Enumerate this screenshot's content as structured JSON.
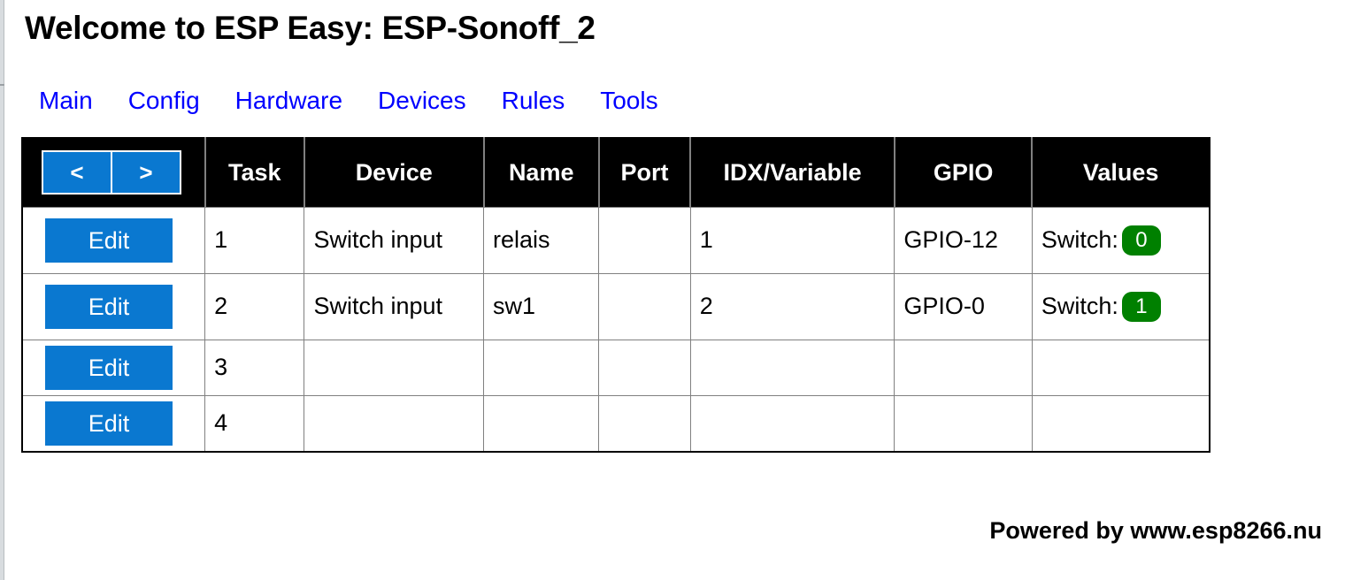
{
  "page": {
    "title": "Welcome to ESP Easy: ESP-Sonoff_2",
    "footer": "Powered by www.esp8266.nu"
  },
  "nav": {
    "items": [
      {
        "label": "Main"
      },
      {
        "label": "Config"
      },
      {
        "label": "Hardware"
      },
      {
        "label": "Devices"
      },
      {
        "label": "Rules"
      },
      {
        "label": "Tools"
      }
    ],
    "link_color": "#0000ff"
  },
  "table": {
    "pager": {
      "prev_label": "<",
      "next_label": ">"
    },
    "headers": [
      "Task",
      "Device",
      "Name",
      "Port",
      "IDX/Variable",
      "GPIO",
      "Values"
    ],
    "edit_label": "Edit",
    "button_color": "#0a78d0",
    "badge_color": "#008000",
    "header_background": "#000000",
    "rows": [
      {
        "edit": "Edit",
        "task": "1",
        "device": "Switch input",
        "name": "relais",
        "port": "",
        "idx": "1",
        "gpio": "GPIO-12",
        "value_label": "Switch:",
        "value_badge": "0"
      },
      {
        "edit": "Edit",
        "task": "2",
        "device": "Switch input",
        "name": "sw1",
        "port": "",
        "idx": "2",
        "gpio": "GPIO-0",
        "value_label": "Switch:",
        "value_badge": "1"
      },
      {
        "edit": "Edit",
        "task": "3",
        "device": "",
        "name": "",
        "port": "",
        "idx": "",
        "gpio": "",
        "value_label": "",
        "value_badge": ""
      },
      {
        "edit": "Edit",
        "task": "4",
        "device": "",
        "name": "",
        "port": "",
        "idx": "",
        "gpio": "",
        "value_label": "",
        "value_badge": ""
      }
    ]
  }
}
